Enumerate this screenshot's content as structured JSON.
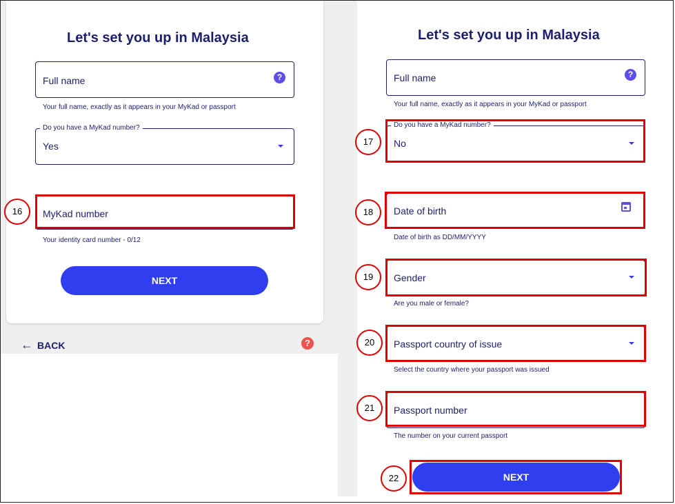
{
  "left": {
    "title": "Let's set you up in Malaysia",
    "full_name": {
      "label": "Full name",
      "helper": "Your full name, exactly as it appears in your MyKad or passport"
    },
    "mykad_question": {
      "label": "Do you have a MyKad number?",
      "value": "Yes"
    },
    "mykad_number": {
      "label": "MyKad number",
      "helper": "Your identity card number - 0/12"
    },
    "next_label": "NEXT",
    "back_label": "BACK",
    "help_glyph": "?"
  },
  "right": {
    "title": "Let's set you up in Malaysia",
    "full_name": {
      "label": "Full name",
      "helper": "Your full name, exactly as it appears in your MyKad or passport"
    },
    "mykad_question": {
      "label": "Do you have a MyKad number?",
      "value": "No"
    },
    "dob": {
      "label": "Date of birth",
      "helper": "Date of birth as DD/MM/YYYY"
    },
    "gender": {
      "label": "Gender",
      "helper": "Are you male or female?"
    },
    "passport_country": {
      "label": "Passport country of issue",
      "helper": "Select the country where your passport was issued"
    },
    "passport_number": {
      "label": "Passport number",
      "helper": "The number on your current passport"
    },
    "next_label": "NEXT",
    "help_glyph": "?"
  },
  "annotations": [
    "16",
    "17",
    "18",
    "19",
    "20",
    "21",
    "22"
  ],
  "colors": {
    "primary": "#2f3ff0",
    "text": "#1b1f6e",
    "icon": "#5d4ee8",
    "annotation": "#e00000",
    "help_red": "#ef5350"
  },
  "icons": {
    "help": "help-circle-icon",
    "dropdown": "caret-down-icon",
    "calendar": "calendar-icon",
    "back": "arrow-left-icon"
  }
}
